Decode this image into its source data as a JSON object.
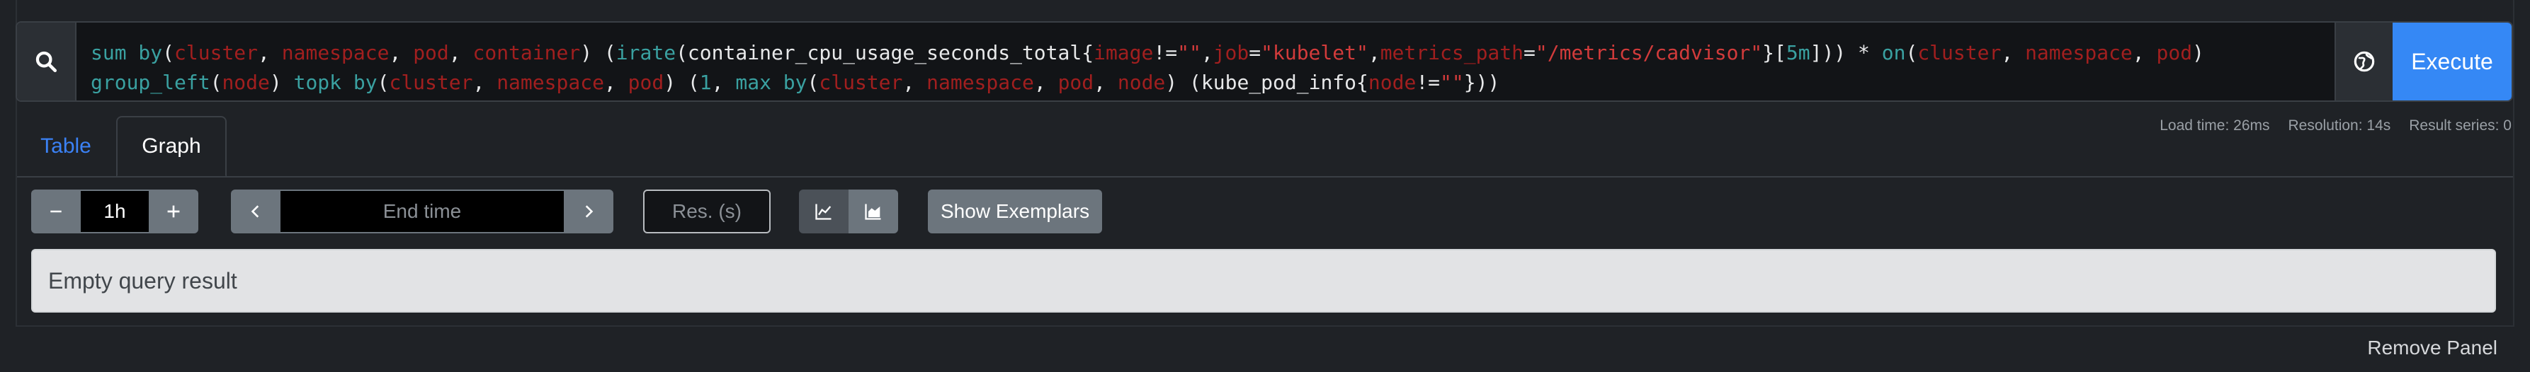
{
  "query": {
    "tokens": [
      {
        "t": "sum by",
        "c": "fn"
      },
      {
        "t": "(",
        "c": "op"
      },
      {
        "t": "cluster",
        "c": "lbl"
      },
      {
        "t": ", ",
        "c": "op"
      },
      {
        "t": "namespace",
        "c": "lbl"
      },
      {
        "t": ", ",
        "c": "op"
      },
      {
        "t": "pod",
        "c": "lbl"
      },
      {
        "t": ", ",
        "c": "op"
      },
      {
        "t": "container",
        "c": "lbl"
      },
      {
        "t": ") (",
        "c": "op"
      },
      {
        "t": "irate",
        "c": "fn"
      },
      {
        "t": "(container_cpu_usage_seconds_total{",
        "c": "op"
      },
      {
        "t": "image",
        "c": "lbl"
      },
      {
        "t": "!=",
        "c": "op"
      },
      {
        "t": "\"\"",
        "c": "str"
      },
      {
        "t": ",",
        "c": "op"
      },
      {
        "t": "job",
        "c": "lbl"
      },
      {
        "t": "=",
        "c": "op"
      },
      {
        "t": "\"kubelet\"",
        "c": "str"
      },
      {
        "t": ",",
        "c": "op"
      },
      {
        "t": "metrics_path",
        "c": "lbl"
      },
      {
        "t": "=",
        "c": "op"
      },
      {
        "t": "\"/metrics/cadvisor\"",
        "c": "str"
      },
      {
        "t": "}[",
        "c": "op"
      },
      {
        "t": "5m",
        "c": "dur"
      },
      {
        "t": "])) * ",
        "c": "op"
      },
      {
        "t": "on",
        "c": "fn"
      },
      {
        "t": "(",
        "c": "op"
      },
      {
        "t": "cluster",
        "c": "lbl"
      },
      {
        "t": ", ",
        "c": "op"
      },
      {
        "t": "namespace",
        "c": "lbl"
      },
      {
        "t": ", ",
        "c": "op"
      },
      {
        "t": "pod",
        "c": "lbl"
      },
      {
        "t": ") ",
        "c": "op"
      },
      {
        "t": "group_left",
        "c": "fn"
      },
      {
        "t": "(",
        "c": "op"
      },
      {
        "t": "node",
        "c": "lbl"
      },
      {
        "t": ") ",
        "c": "op"
      },
      {
        "t": "topk by",
        "c": "fn"
      },
      {
        "t": "(",
        "c": "op"
      },
      {
        "t": "cluster",
        "c": "lbl"
      },
      {
        "t": ", ",
        "c": "op"
      },
      {
        "t": "namespace",
        "c": "lbl"
      },
      {
        "t": ", ",
        "c": "op"
      },
      {
        "t": "pod",
        "c": "lbl"
      },
      {
        "t": ") (",
        "c": "op"
      },
      {
        "t": "1",
        "c": "num"
      },
      {
        "t": ", ",
        "c": "op"
      },
      {
        "t": "max by",
        "c": "fn"
      },
      {
        "t": "(",
        "c": "op"
      },
      {
        "t": "cluster",
        "c": "lbl"
      },
      {
        "t": ", ",
        "c": "op"
      },
      {
        "t": "namespace",
        "c": "lbl"
      },
      {
        "t": ", ",
        "c": "op"
      },
      {
        "t": "pod",
        "c": "lbl"
      },
      {
        "t": ", ",
        "c": "op"
      },
      {
        "t": "node",
        "c": "lbl"
      },
      {
        "t": ") (kube_pod_info{",
        "c": "op"
      },
      {
        "t": "node",
        "c": "lbl"
      },
      {
        "t": "!=",
        "c": "op"
      },
      {
        "t": "\"\"",
        "c": "str"
      },
      {
        "t": "}))",
        "c": "op"
      }
    ]
  },
  "icons": {
    "search": "search-icon",
    "metrics_explorer": "globe-icon",
    "range_minus": "minus-icon",
    "range_plus": "plus-icon",
    "time_back": "chevron-left-icon",
    "time_forward": "chevron-right-icon",
    "unstacked": "line-chart-icon",
    "stacked": "area-chart-icon"
  },
  "execute_label": "Execute",
  "tabs": [
    {
      "label": "Table",
      "active": false
    },
    {
      "label": "Graph",
      "active": true
    }
  ],
  "stats": {
    "load_time": "Load time: 26ms",
    "resolution": "Resolution: 14s",
    "result_series": "Result series: 0"
  },
  "controls": {
    "range_value": "1h",
    "end_time_placeholder": "End time",
    "resolution_placeholder": "Res. (s)",
    "exemplars_label": "Show Exemplars"
  },
  "result": {
    "message": "Empty query result"
  },
  "remove_panel_label": "Remove Panel",
  "colors": {
    "accent": "#3588f5",
    "background": "#1f2226",
    "function": "#3aa1a1",
    "label_name": "#a11f1f",
    "string": "#d23b3b"
  }
}
